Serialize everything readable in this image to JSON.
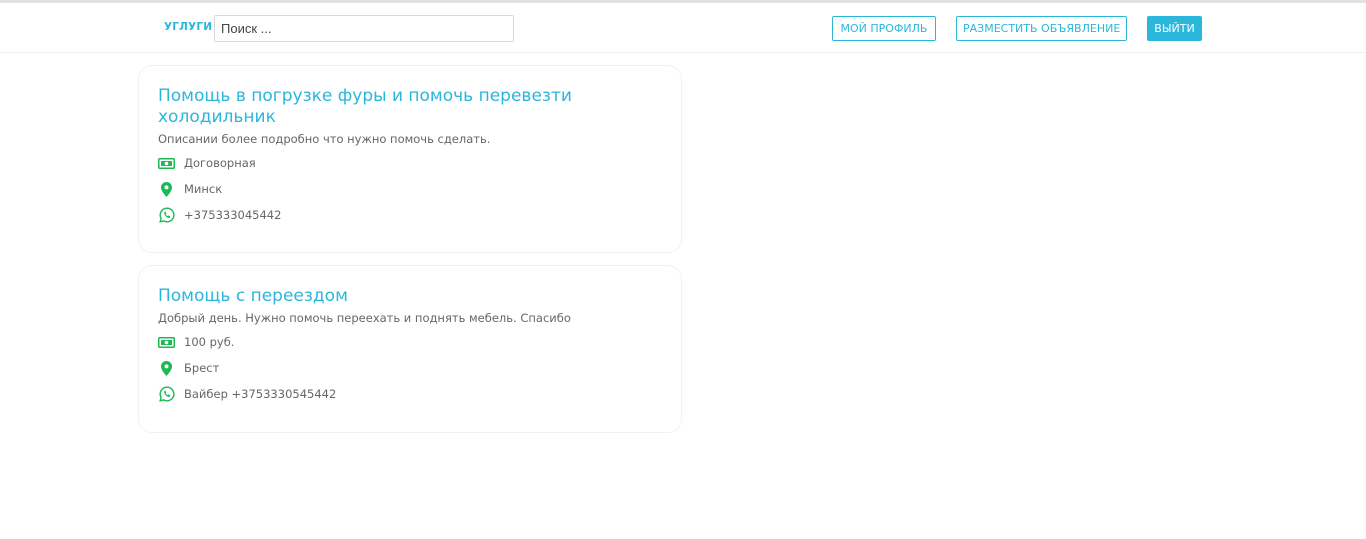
{
  "header": {
    "logo": "УГЛУГИ",
    "search_placeholder": "Поиск ...",
    "profile_label": "МОЙ ПРОФИЛЬ",
    "post_ad_label": "РАЗМЕСТИТЬ ОБЪЯВЛЕНИЕ",
    "logout_label": "ВЫЙТИ"
  },
  "colors": {
    "accent": "#2bb6dc",
    "icon_green": "#1db954"
  },
  "listings": [
    {
      "title": "Помощь в погрузке фуры и помочь перевезти холодильник",
      "description": "Описании более подробно что нужно помочь сделать.",
      "price": "Договорная",
      "location": "Минск",
      "phone": "+375333045442"
    },
    {
      "title": "Помощь с переездом",
      "description": "Добрый день. Нужно помочь переехать и поднять мебель. Спасибо",
      "price": "100 руб.",
      "location": "Брест",
      "phone": "Вайбер +3753330545442"
    }
  ]
}
